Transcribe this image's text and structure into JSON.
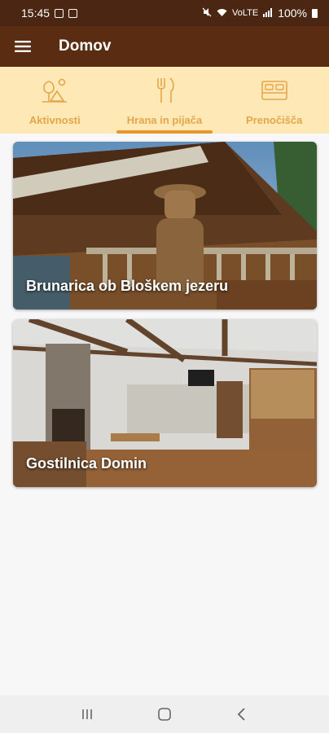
{
  "status_bar": {
    "time": "15:45",
    "network": "VoLTE",
    "battery": "100%"
  },
  "app_bar": {
    "title": "Domov",
    "menu_icon": "hamburger-menu-icon"
  },
  "tabs": [
    {
      "label": "Aktivnosti",
      "icon": "activities-icon",
      "active": false
    },
    {
      "label": "Hrana in pijača",
      "icon": "fork-knife-icon",
      "active": true
    },
    {
      "label": "Prenočišča",
      "icon": "bed-icon",
      "active": false
    }
  ],
  "cards": [
    {
      "title": "Brunarica ob Bloškem jezeru"
    },
    {
      "title": "Gostilnica Domin"
    }
  ],
  "nav_bar": {
    "recents_icon": "recents-icon",
    "home_icon": "home-icon",
    "back_icon": "back-icon"
  },
  "colors": {
    "status_bar": "#4b2612",
    "app_bar": "#5a2d12",
    "tab_bar": "#fde8b6",
    "accent": "#e8962b"
  }
}
